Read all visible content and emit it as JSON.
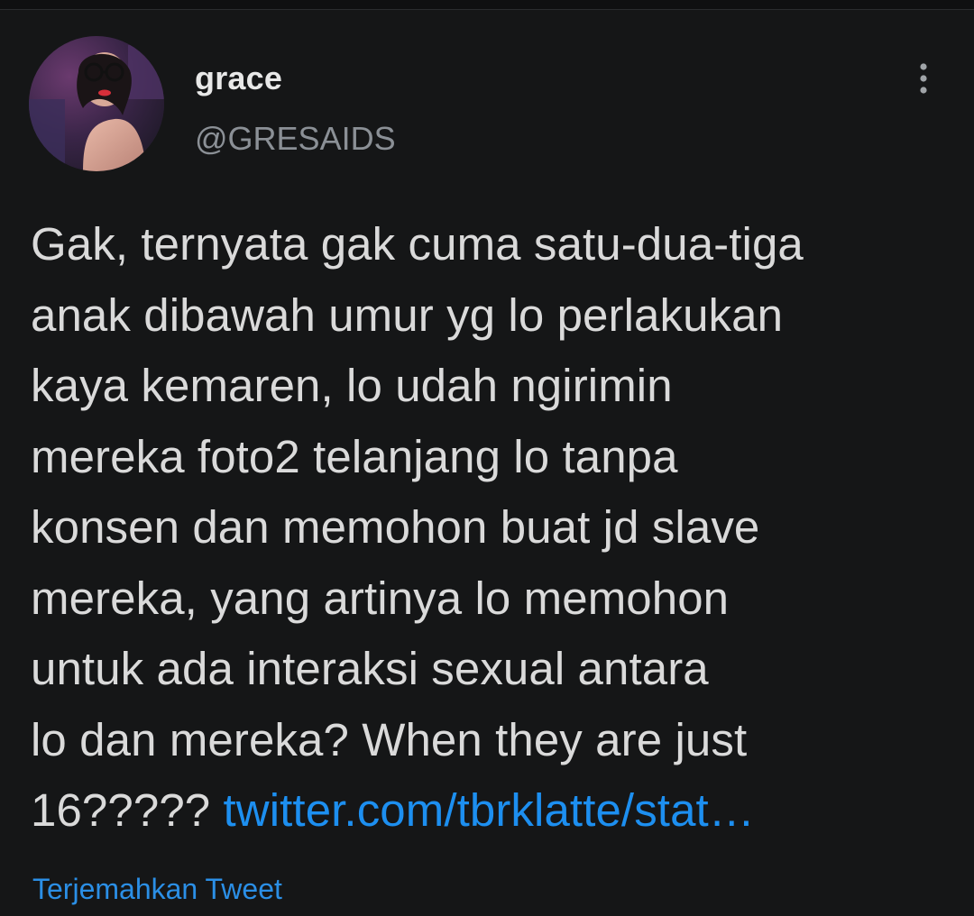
{
  "tweet": {
    "author": {
      "display_name": "grace",
      "handle": "@GRESAIDS",
      "avatar": "avatar-photo"
    },
    "more_icon": "more-vertical-icon",
    "text": "Gak, ternyata gak cuma satu-dua-tiga\nanak dibawah umur yg lo perlakukan\nkaya kemaren, lo udah ngirimin\nmereka foto2 telanjang lo tanpa\nkonsen dan memohon buat jd slave\nmereka, yang artinya lo memohon\nuntuk ada interaksi sexual antara\nlo dan mereka? When they are just\n16?????",
    "link_text": "twitter.com/tbrklatte/stat…",
    "translate_label": "Terjemahkan Tweet"
  },
  "colors": {
    "background": "#151617",
    "text": "#dadada",
    "handle": "#8b9096",
    "link": "#1d8ff0"
  }
}
